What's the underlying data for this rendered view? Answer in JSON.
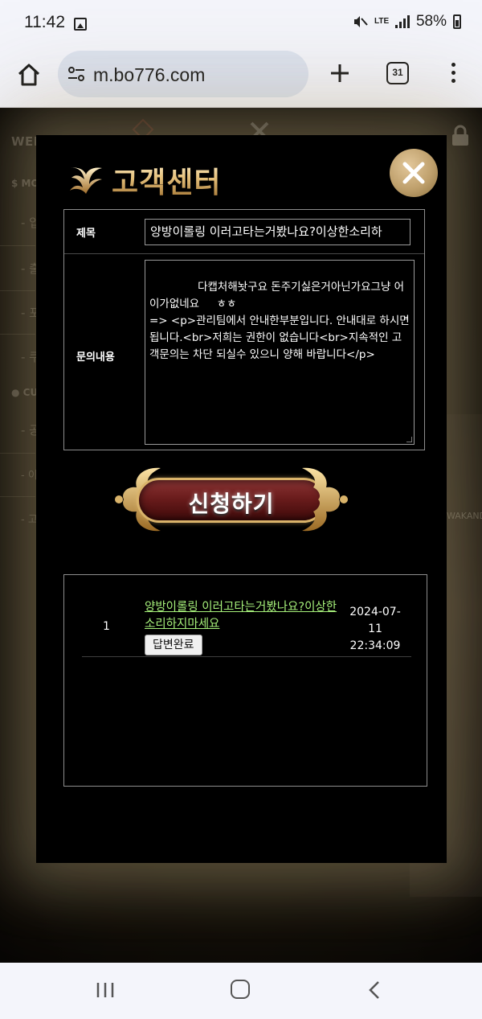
{
  "status_bar": {
    "time": "11:42",
    "network": "LTE",
    "battery": "58%",
    "icons": [
      "image-icon",
      "mute-icon",
      "lte-icon",
      "signal-icon",
      "battery-icon"
    ]
  },
  "browser": {
    "url": "m.bo776.com",
    "tab_count": "31",
    "icons": [
      "home-icon",
      "site-settings-icon",
      "new-tab-plus-icon",
      "tabs-icon",
      "menu-icon"
    ]
  },
  "background_site": {
    "welcome": "WELCOME TO",
    "money_header": "$ MONEY",
    "custom_header": "● CUSTO",
    "side_items": [
      "- 입금",
      "- 출금",
      "- 포인",
      "- 쿠폰",
      "- 공지",
      "- 이벤트안내 EVENT",
      "- 고객센터 CUSTO"
    ],
    "right_text": "WAKANDA"
  },
  "modal": {
    "title": "고객센터",
    "form": {
      "subject_label": "제목",
      "subject_value": "양방이롤링 이러고타는거봤나요?이상한소리하",
      "content_label": "문의내용",
      "content_value": "        다캡처해놧구요 돈주기싫은거아닌가요그냥 어이가없네요     ㅎㅎ\n=> <p>관리팀에서 안내한부분입니다. 안내대로 하시면 됩니다.<br>저희는 권한이 없습니다<br>지속적인 고객문의는 차단 되실수 있으니 양해 바랍니다</p>"
    },
    "submit_label": "신청하기",
    "inquiries": [
      {
        "num": "1",
        "title": "양방이롤링 이러고타는거봤나요?이상한소리하지마세요",
        "status": "답변완료",
        "date": "2024-07-11",
        "time": "22:34:09"
      }
    ]
  },
  "colors": {
    "accent_gold": "#e5c07a",
    "link_green": "#a6f07a",
    "button_red": "#6a1c1c"
  }
}
